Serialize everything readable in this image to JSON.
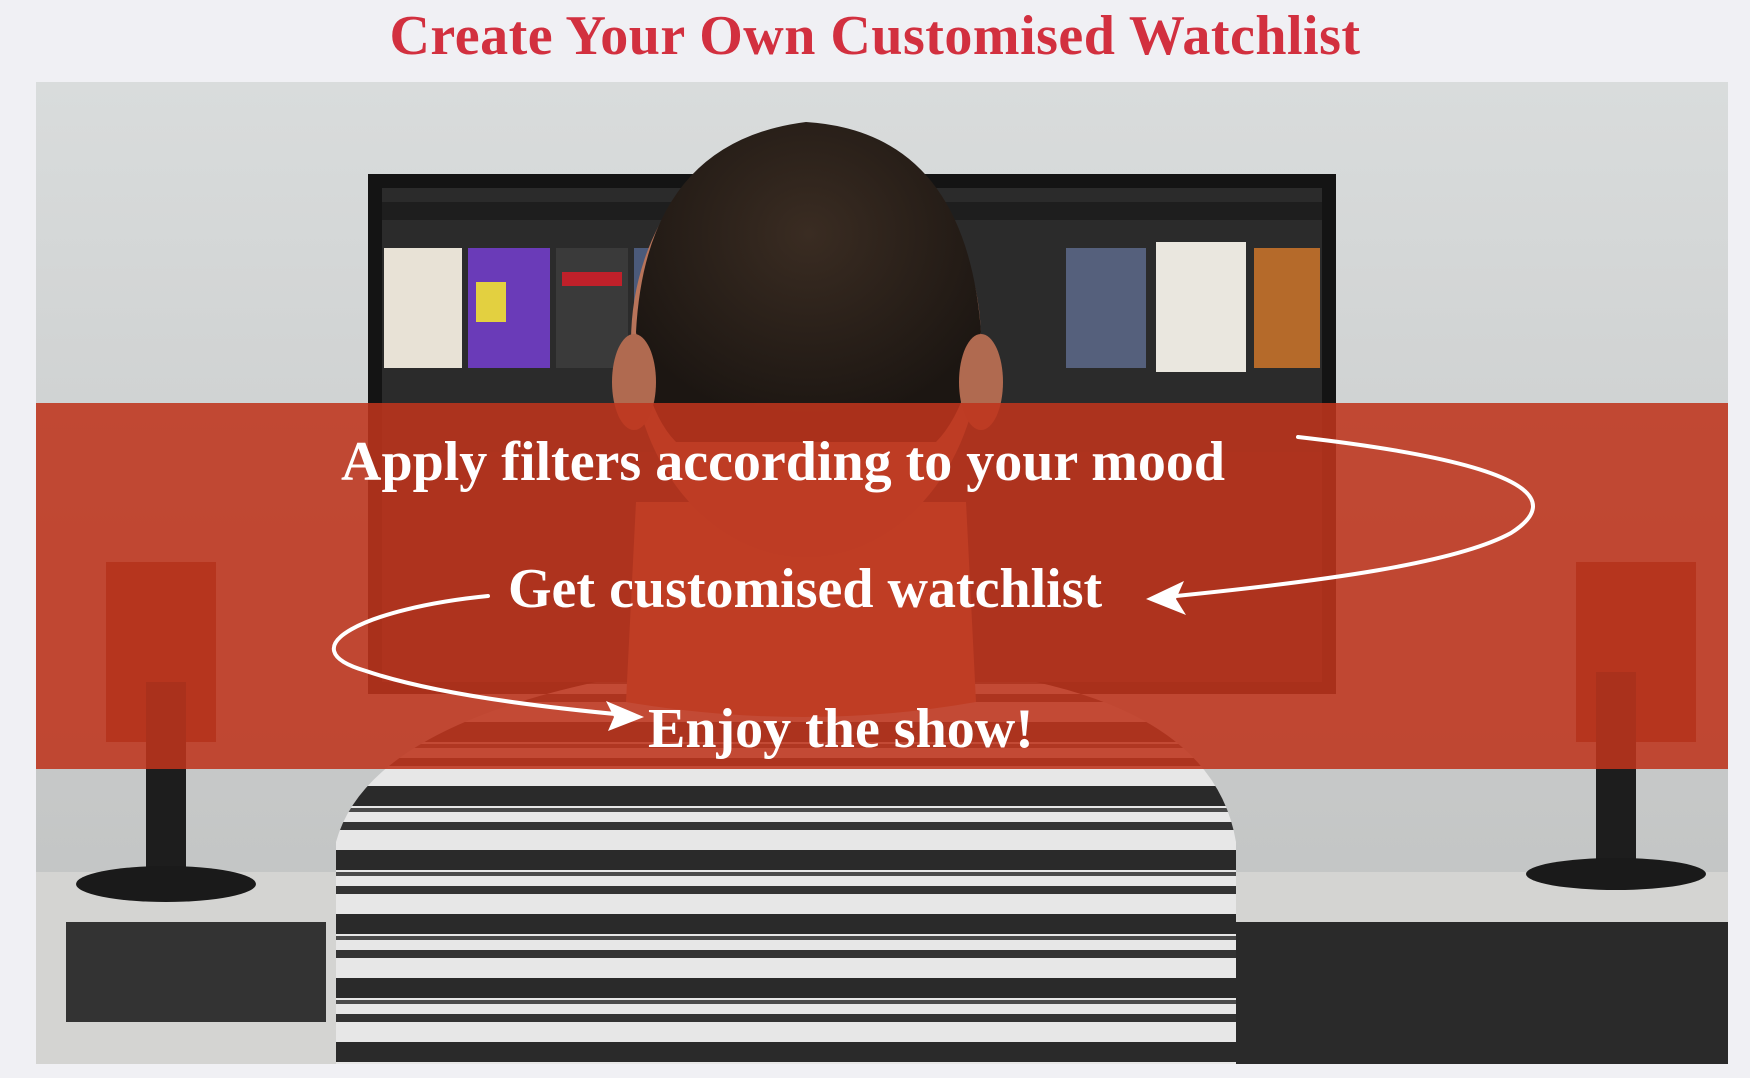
{
  "title": "Create Your Own Customised Watchlist",
  "banner": {
    "steps": [
      "Apply filters according to your mood",
      "Get customised watchlist",
      "Enjoy the show!"
    ]
  },
  "colors": {
    "title": "#d2303f",
    "banner": "#be341c",
    "text": "#ffffff",
    "background": "#f0f0f4"
  },
  "icons": {
    "arrow_1": "curved-arrow-icon",
    "arrow_2": "curved-arrow-icon"
  }
}
